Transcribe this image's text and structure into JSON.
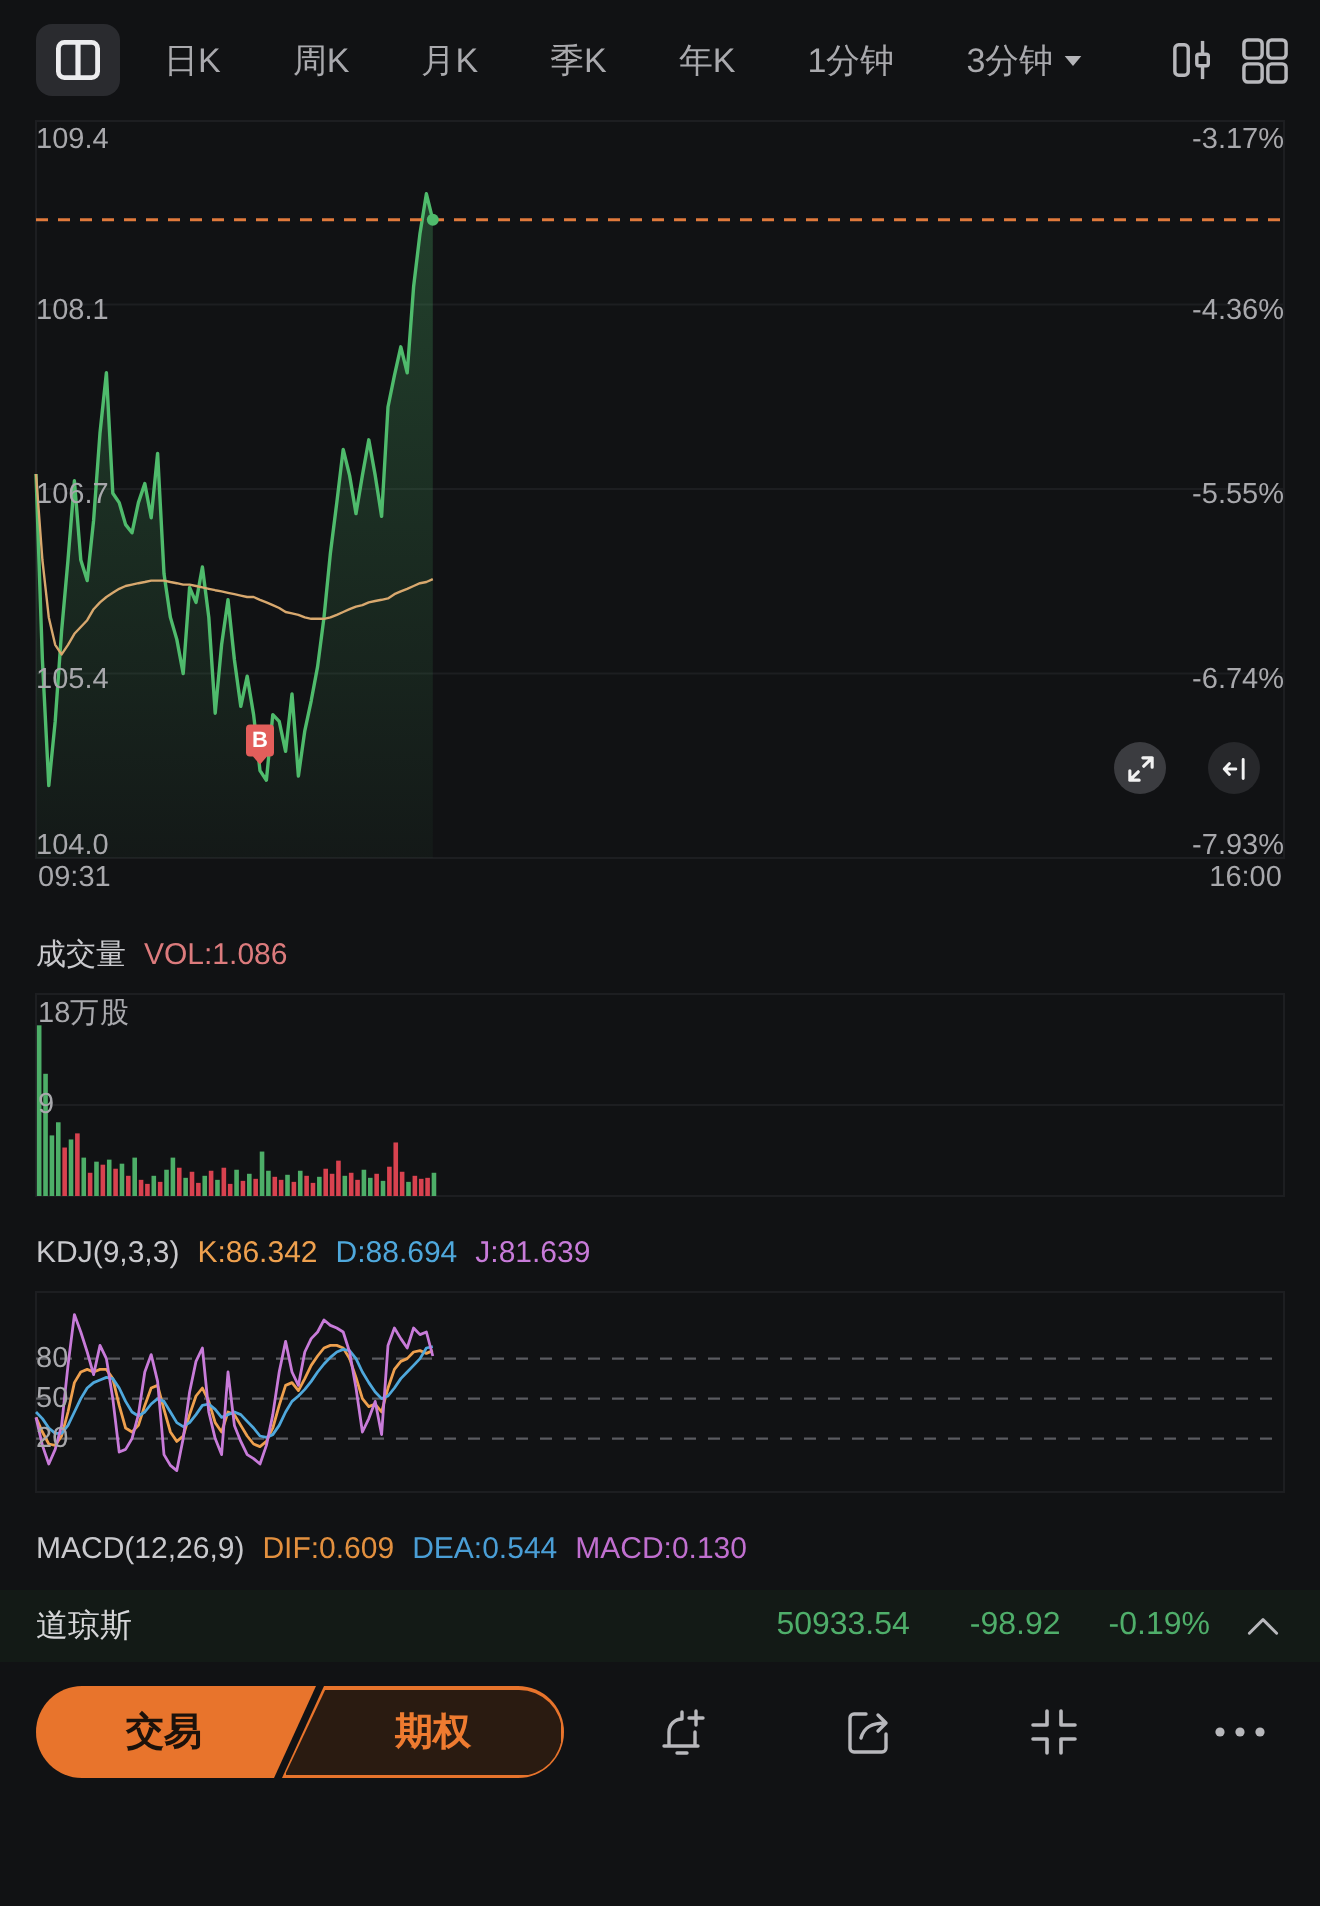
{
  "tabs": [
    {
      "kind": "icon",
      "selected": true
    },
    {
      "kind": "text",
      "label": "日K",
      "selected": false
    },
    {
      "kind": "text",
      "label": "周K",
      "selected": false
    },
    {
      "kind": "text",
      "label": "月K",
      "selected": false
    },
    {
      "kind": "text",
      "label": "季K",
      "selected": false
    },
    {
      "kind": "text",
      "label": "年K",
      "selected": false
    },
    {
      "kind": "text",
      "label": "1分钟",
      "selected": false
    },
    {
      "kind": "menu",
      "label": "3分钟",
      "selected": false
    }
  ],
  "price_chart": {
    "percent_labels": [
      "-3.17%",
      "-4.36%",
      "-5.55%",
      "-6.74%",
      "-7.93%"
    ],
    "chart_data": {
      "type": "line",
      "grid": true,
      "categories": [
        null,
        null,
        null,
        null,
        null,
        null,
        "09:31",
        null,
        null,
        null,
        null,
        null,
        null,
        null,
        null,
        null,
        null,
        null,
        null,
        null,
        null,
        null,
        null,
        null,
        null,
        null,
        null,
        null,
        null,
        null,
        null,
        null,
        null,
        null,
        null,
        null,
        null,
        null,
        null,
        null,
        null,
        null,
        null,
        null,
        null,
        null,
        null,
        null,
        null,
        null,
        null,
        null,
        null,
        null,
        null,
        null,
        null,
        null,
        null,
        null,
        null,
        null,
        null,
        null,
        null,
        null,
        null,
        null,
        null,
        null,
        null,
        null,
        null,
        null,
        null,
        null,
        null,
        null,
        null,
        null,
        null,
        null,
        null,
        null,
        null,
        null,
        null,
        null,
        null,
        null,
        null,
        null,
        null,
        null,
        null,
        null,
        null,
        null,
        null,
        null,
        null,
        null,
        null,
        null,
        null,
        null,
        null,
        null,
        null,
        null,
        null,
        null,
        null,
        null,
        null,
        null,
        null,
        null,
        null,
        null,
        null,
        null,
        null,
        null,
        null,
        null,
        null,
        null,
        null,
        null,
        null,
        null,
        null,
        null,
        null,
        null,
        null,
        null,
        null,
        null,
        null,
        null,
        null,
        null,
        null,
        null,
        null,
        null,
        null,
        null,
        null,
        null,
        null,
        null,
        null,
        null,
        null,
        null,
        null,
        null,
        null,
        null,
        null,
        null,
        null,
        null,
        null,
        null,
        null,
        null,
        null,
        null,
        null,
        null,
        null,
        null,
        null,
        null,
        null,
        null,
        null,
        null,
        null,
        null,
        null,
        null,
        null,
        null,
        null,
        "16:00",
        null,
        null,
        null,
        null,
        null,
        null
      ],
      "ylim": [
        104,
        109.4
      ],
      "yticks": [
        109.4,
        {
          "value": 108.05,
          "label": "108.1"
        },
        106.7,
        {
          "value": 105.35,
          "label": "105.4"
        },
        {
          "value": 104,
          "label": "104.0"
        }
      ],
      "series": [
        {
          "color": "#4fbb6c",
          "values": [
            106.81,
            105.45,
            104.53,
            105.0,
            105.66,
            106.18,
            106.76,
            106.18,
            106.03,
            106.47,
            107.11,
            107.55,
            106.67,
            106.6,
            106.44,
            106.38,
            106.6,
            106.74,
            106.49,
            106.96,
            106.08,
            105.76,
            105.6,
            105.35,
            105.98,
            105.87,
            106.13,
            105.76,
            105.06,
            105.56,
            105.89,
            105.45,
            105.11,
            105.33,
            105.05,
            104.64,
            104.57,
            105.05,
            105.0,
            104.78,
            105.2,
            104.6,
            104.93,
            105.15,
            105.4,
            105.76,
            106.23,
            106.6,
            106.99,
            106.8,
            106.52,
            106.8,
            107.06,
            106.8,
            106.5,
            107.3,
            107.53,
            107.74,
            107.55,
            108.18,
            108.57,
            108.86,
            108.67,
            null,
            null,
            null,
            null,
            null,
            null,
            null,
            null,
            null,
            null,
            null,
            null,
            null,
            null,
            null,
            null,
            null,
            null,
            null,
            null,
            null,
            null,
            null,
            null,
            null,
            null,
            null,
            null,
            null,
            null,
            null,
            null,
            null,
            null,
            null,
            null,
            null,
            null,
            null,
            null,
            null,
            null,
            null,
            null,
            null,
            null,
            null,
            null,
            null,
            null,
            null,
            null,
            null,
            null,
            null,
            null,
            null,
            null,
            null,
            null,
            null,
            null,
            null,
            null,
            null,
            null,
            null,
            null,
            null,
            null,
            null,
            null,
            null,
            null,
            null,
            null,
            null,
            null,
            null,
            null,
            null,
            null,
            null,
            null,
            null,
            null,
            null,
            null,
            null,
            null,
            null,
            null,
            null,
            null,
            null,
            null,
            null,
            null,
            null,
            null,
            null,
            null,
            null,
            null,
            null,
            null,
            null,
            null,
            null,
            null,
            null,
            null,
            null,
            null,
            null,
            null,
            null,
            null,
            null,
            null,
            null,
            null,
            null,
            null,
            null,
            null,
            null,
            null,
            null,
            null,
            null,
            null,
            null
          ]
        },
        {
          "color": "#d8a86e",
          "values": [
            106.81,
            106.18,
            105.76,
            105.56,
            105.49,
            105.56,
            105.64,
            105.69,
            105.74,
            105.82,
            105.87,
            105.91,
            105.94,
            105.97,
            105.99,
            106.0,
            106.01,
            106.02,
            106.03,
            106.03,
            106.03,
            106.02,
            106.01,
            106.0,
            106.0,
            105.99,
            105.98,
            105.97,
            105.96,
            105.95,
            105.94,
            105.93,
            105.92,
            105.91,
            105.91,
            105.89,
            105.87,
            105.85,
            105.83,
            105.8,
            105.79,
            105.78,
            105.76,
            105.75,
            105.75,
            105.75,
            105.76,
            105.78,
            105.8,
            105.82,
            105.84,
            105.85,
            105.87,
            105.88,
            105.89,
            105.9,
            105.93,
            105.95,
            105.97,
            105.99,
            106.01,
            106.02,
            106.04,
            null,
            null,
            null,
            null,
            null,
            null,
            null,
            null,
            null,
            null,
            null,
            null,
            null,
            null,
            null,
            null,
            null,
            null,
            null,
            null,
            null,
            null,
            null,
            null,
            null,
            null,
            null,
            null,
            null,
            null,
            null,
            null,
            null,
            null,
            null,
            null,
            null,
            null,
            null,
            null,
            null,
            null,
            null,
            null,
            null,
            null,
            null,
            null,
            null,
            null,
            null,
            null,
            null,
            null,
            null,
            null,
            null,
            null,
            null,
            null,
            null,
            null,
            null,
            null,
            null,
            null,
            null,
            null,
            null,
            null,
            null,
            null,
            null,
            null,
            null,
            null,
            null,
            null,
            null,
            null,
            null,
            null,
            null,
            null,
            null,
            null,
            null,
            null,
            null,
            null,
            null,
            null,
            null,
            null,
            null,
            null,
            null,
            null,
            null,
            null,
            null,
            null,
            null,
            null,
            null,
            null,
            null,
            null,
            null,
            null,
            null,
            null,
            null,
            null,
            null,
            null,
            null,
            null,
            null,
            null,
            null,
            null,
            null,
            null,
            null,
            null,
            null,
            null,
            null,
            null,
            null,
            null,
            null
          ]
        }
      ],
      "ref_lines": [
        {
          "axis": "y",
          "value": 108.67,
          "color": "#e07a3c"
        }
      ],
      "annotations": [
        {
          "text": "B",
          "y": 104.64
        }
      ]
    }
  },
  "volume": {
    "title": "成交量",
    "reading": "VOL:1.086",
    "chart_data": {
      "type": "bar",
      "stacked": true,
      "grid": true,
      "categories": [
        null,
        null,
        null,
        null,
        null,
        null,
        null,
        null,
        null,
        null,
        null,
        null,
        null,
        null,
        null,
        null,
        null,
        null,
        null,
        null,
        null,
        null,
        null,
        null,
        null,
        null,
        null,
        null,
        null,
        null,
        null,
        null,
        null,
        null,
        null,
        null,
        null,
        null,
        null,
        null,
        null,
        null,
        null,
        null,
        null,
        null,
        null,
        null,
        null,
        null,
        null,
        null,
        null,
        null,
        null,
        null,
        null,
        null,
        null,
        null,
        null,
        null,
        null,
        null,
        null,
        null,
        null,
        null,
        null,
        null,
        null,
        null,
        null,
        null,
        null,
        null,
        null,
        null,
        null,
        null,
        null,
        null,
        null,
        null,
        null,
        null,
        null,
        null,
        null,
        null,
        null,
        null,
        null,
        null,
        null,
        null,
        null,
        null,
        null,
        null,
        null,
        null,
        null,
        null,
        null,
        null,
        null,
        null,
        null,
        null,
        null,
        null,
        null,
        null,
        null,
        null,
        null,
        null,
        null,
        null,
        null,
        null,
        null,
        null,
        null,
        null,
        null,
        null,
        null,
        null,
        null,
        null,
        null,
        null,
        null,
        null,
        null,
        null,
        null,
        null,
        null,
        null,
        null,
        null,
        null,
        null,
        null,
        null,
        null,
        null,
        null,
        null,
        null,
        null,
        null,
        null,
        null,
        null,
        null,
        null,
        null,
        null,
        null,
        null,
        null,
        null,
        null,
        null,
        null,
        null,
        null,
        null,
        null,
        null,
        null,
        null,
        null,
        null,
        null,
        null,
        null,
        null,
        null,
        null,
        null,
        null,
        null,
        null,
        null,
        null,
        null,
        null,
        null,
        null,
        null,
        null
      ],
      "ylim": [
        0,
        20
      ],
      "yticks": [
        {
          "value": 18,
          "label": "18万股"
        },
        9
      ],
      "series": [
        {
          "color": "#4dae68",
          "values": [
            16.9,
            12.1,
            6.0,
            7.3,
            null,
            5.6,
            null,
            3.8,
            null,
            3.4,
            null,
            3.6,
            null,
            3.2,
            null,
            3.8,
            null,
            null,
            2.0,
            null,
            2.6,
            3.8,
            null,
            1.8,
            null,
            null,
            2.0,
            null,
            1.6,
            null,
            null,
            2.6,
            null,
            2.2,
            null,
            4.4,
            2.5,
            null,
            null,
            2.1,
            null,
            2.5,
            null,
            null,
            1.9,
            null,
            null,
            null,
            2.0,
            null,
            null,
            2.6,
            1.8,
            null,
            1.5,
            null,
            null,
            null,
            1.4,
            null,
            null,
            null,
            2.3,
            null,
            null,
            null,
            null,
            null,
            null,
            null,
            null,
            null,
            null,
            null,
            null,
            null,
            null,
            null,
            null,
            null,
            null,
            null,
            null,
            null,
            null,
            null,
            null,
            null,
            null,
            null,
            null,
            null,
            null,
            null,
            null,
            null,
            null,
            null,
            null,
            null,
            null,
            null,
            null,
            null,
            null,
            null,
            null,
            null,
            null,
            null,
            null,
            null,
            null,
            null,
            null,
            null,
            null,
            null,
            null,
            null,
            null,
            null,
            null,
            null,
            null,
            null,
            null,
            null,
            null,
            null,
            null,
            null,
            null,
            null,
            null,
            null,
            null,
            null,
            null,
            null,
            null,
            null,
            null,
            null,
            null,
            null,
            null,
            null,
            null,
            null,
            null,
            null,
            null,
            null,
            null,
            null,
            null,
            null,
            null,
            null,
            null,
            null,
            null,
            null,
            null,
            null,
            null,
            null,
            null,
            null,
            null,
            null,
            null,
            null,
            null,
            null,
            null,
            null,
            null,
            null,
            null,
            null,
            null,
            null,
            null,
            null,
            null,
            null,
            null,
            null,
            null,
            null,
            null,
            null,
            null,
            null
          ]
        },
        {
          "color": "#d8424f",
          "values": [
            null,
            null,
            null,
            null,
            4.8,
            null,
            6.2,
            null,
            2.3,
            null,
            3.1,
            null,
            2.7,
            null,
            2.0,
            null,
            1.6,
            1.2,
            null,
            1.4,
            null,
            null,
            2.8,
            null,
            2.4,
            1.3,
            null,
            2.5,
            null,
            2.8,
            1.2,
            null,
            1.5,
            null,
            1.7,
            null,
            null,
            1.9,
            1.6,
            null,
            1.4,
            null,
            2.0,
            1.3,
            null,
            2.7,
            2.2,
            3.5,
            null,
            2.3,
            1.6,
            null,
            null,
            2.2,
            null,
            2.9,
            5.3,
            2.4,
            null,
            2.0,
            1.7,
            1.8,
            null,
            null,
            null,
            null,
            null,
            null,
            null,
            null,
            null,
            null,
            null,
            null,
            null,
            null,
            null,
            null,
            null,
            null,
            null,
            null,
            null,
            null,
            null,
            null,
            null,
            null,
            null,
            null,
            null,
            null,
            null,
            null,
            null,
            null,
            null,
            null,
            null,
            null,
            null,
            null,
            null,
            null,
            null,
            null,
            null,
            null,
            null,
            null,
            null,
            null,
            null,
            null,
            null,
            null,
            null,
            null,
            null,
            null,
            null,
            null,
            null,
            null,
            null,
            null,
            null,
            null,
            null,
            null,
            null,
            null,
            null,
            null,
            null,
            null,
            null,
            null,
            null,
            null,
            null,
            null,
            null,
            null,
            null,
            null,
            null,
            null,
            null,
            null,
            null,
            null,
            null,
            null,
            null,
            null,
            null,
            null,
            null,
            null,
            null,
            null,
            null,
            null,
            null,
            null,
            null,
            null,
            null,
            null,
            null,
            null,
            null,
            null,
            null,
            null,
            null,
            null,
            null,
            null,
            null,
            null,
            null,
            null,
            null,
            null,
            null,
            null,
            null,
            null,
            null,
            null,
            null,
            null,
            null,
            null
          ]
        }
      ]
    }
  },
  "kdj": {
    "title": "KDJ(9,3,3)",
    "readings": [
      {
        "text": "K:86.342",
        "color": "#eea04e"
      },
      {
        "text": "D:88.694",
        "color": "#4fa8dc"
      },
      {
        "text": "J:81.639",
        "color": "#c87bd9"
      }
    ],
    "chart_data": {
      "type": "line",
      "grid": true,
      "categories": [
        null,
        null,
        null,
        null,
        null,
        null,
        null,
        null,
        null,
        null,
        null,
        null,
        null,
        null,
        null,
        null,
        null,
        null,
        null,
        null,
        null,
        null,
        null,
        null,
        null,
        null,
        null,
        null,
        null,
        null,
        null,
        null,
        null,
        null,
        null,
        null,
        null,
        null,
        null,
        null,
        null,
        null,
        null,
        null,
        null,
        null,
        null,
        null,
        null,
        null,
        null,
        null,
        null,
        null,
        null,
        null,
        null,
        null,
        null,
        null,
        null,
        null,
        null,
        null,
        null,
        null,
        null,
        null,
        null,
        null,
        null,
        null,
        null,
        null,
        null,
        null,
        null,
        null,
        null,
        null,
        null,
        null,
        null,
        null,
        null,
        null,
        null,
        null,
        null,
        null,
        null,
        null,
        null,
        null,
        null,
        null,
        null,
        null,
        null,
        null,
        null,
        null,
        null,
        null,
        null,
        null,
        null,
        null,
        null,
        null,
        null,
        null,
        null,
        null,
        null,
        null,
        null,
        null,
        null,
        null,
        null,
        null,
        null,
        null,
        null,
        null,
        null,
        null,
        null,
        null,
        null,
        null,
        null,
        null,
        null,
        null,
        null,
        null,
        null,
        null,
        null,
        null,
        null,
        null,
        null,
        null,
        null,
        null,
        null,
        null,
        null,
        null,
        null,
        null,
        null,
        null,
        null,
        null,
        null,
        null,
        null,
        null,
        null,
        null,
        null,
        null,
        null,
        null,
        null,
        null,
        null,
        null,
        null,
        null,
        null,
        null,
        null,
        null,
        null,
        null,
        null,
        null,
        null,
        null,
        null,
        null,
        null,
        null,
        null,
        null,
        null,
        null,
        null,
        null,
        null,
        null
      ],
      "ylim": [
        -20,
        130
      ],
      "yticks": [
        80,
        50,
        20
      ],
      "series": [
        {
          "color": "#eea04e",
          "values": [
            36,
            25,
            16,
            15,
            22,
            40,
            62,
            70,
            72,
            70,
            72,
            72,
            65,
            45,
            28,
            25,
            30,
            45,
            58,
            60,
            42,
            25,
            18,
            22,
            38,
            52,
            58,
            48,
            32,
            25,
            40,
            38,
            30,
            22,
            16,
            14,
            18,
            28,
            45,
            60,
            62,
            56,
            65,
            75,
            82,
            88,
            90,
            90,
            88,
            80,
            66,
            50,
            44,
            46,
            40,
            58,
            72,
            78,
            80,
            85,
            86,
            84,
            86,
            null,
            null,
            null,
            null,
            null,
            null,
            null,
            null,
            null,
            null,
            null,
            null,
            null,
            null,
            null,
            null,
            null,
            null,
            null,
            null,
            null,
            null,
            null,
            null,
            null,
            null,
            null,
            null,
            null,
            null,
            null,
            null,
            null,
            null,
            null,
            null,
            null,
            null,
            null,
            null,
            null,
            null,
            null,
            null,
            null,
            null,
            null,
            null,
            null,
            null,
            null,
            null,
            null,
            null,
            null,
            null,
            null,
            null,
            null,
            null,
            null,
            null,
            null,
            null,
            null,
            null,
            null,
            null,
            null,
            null,
            null,
            null,
            null,
            null,
            null,
            null,
            null,
            null,
            null,
            null,
            null,
            null,
            null,
            null,
            null,
            null,
            null,
            null,
            null,
            null,
            null,
            null,
            null,
            null,
            null,
            null,
            null,
            null,
            null,
            null,
            null,
            null,
            null,
            null,
            null,
            null,
            null,
            null,
            null,
            null,
            null,
            null,
            null,
            null,
            null,
            null,
            null,
            null,
            null,
            null,
            null,
            null,
            null,
            null,
            null,
            null,
            null,
            null,
            null,
            null,
            null,
            null,
            null
          ]
        },
        {
          "color": "#4fa8dc",
          "values": [
            40,
            35,
            28,
            24,
            24,
            30,
            40,
            50,
            58,
            62,
            64,
            66,
            65,
            58,
            48,
            40,
            37,
            40,
            46,
            50,
            48,
            40,
            32,
            29,
            32,
            38,
            45,
            46,
            42,
            36,
            38,
            40,
            38,
            33,
            28,
            22,
            21,
            23,
            30,
            40,
            48,
            52,
            57,
            63,
            70,
            76,
            81,
            85,
            87,
            86,
            80,
            70,
            62,
            55,
            50,
            52,
            58,
            65,
            70,
            75,
            80,
            88,
            89,
            null,
            null,
            null,
            null,
            null,
            null,
            null,
            null,
            null,
            null,
            null,
            null,
            null,
            null,
            null,
            null,
            null,
            null,
            null,
            null,
            null,
            null,
            null,
            null,
            null,
            null,
            null,
            null,
            null,
            null,
            null,
            null,
            null,
            null,
            null,
            null,
            null,
            null,
            null,
            null,
            null,
            null,
            null,
            null,
            null,
            null,
            null,
            null,
            null,
            null,
            null,
            null,
            null,
            null,
            null,
            null,
            null,
            null,
            null,
            null,
            null,
            null,
            null,
            null,
            null,
            null,
            null,
            null,
            null,
            null,
            null,
            null,
            null,
            null,
            null,
            null,
            null,
            null,
            null,
            null,
            null,
            null,
            null,
            null,
            null,
            null,
            null,
            null,
            null,
            null,
            null,
            null,
            null,
            null,
            null,
            null,
            null,
            null,
            null,
            null,
            null,
            null,
            null,
            null,
            null,
            null,
            null,
            null,
            null,
            null,
            null,
            null,
            null,
            null,
            null,
            null,
            null,
            null,
            null,
            null,
            null,
            null,
            null,
            null,
            null,
            null,
            null,
            null,
            null,
            null,
            null,
            null,
            null
          ]
        },
        {
          "color": "#c87bd9",
          "values": [
            36,
            15,
            1,
            12,
            30,
            75,
            113,
            100,
            85,
            68,
            90,
            80,
            50,
            10,
            12,
            20,
            38,
            70,
            83,
            63,
            8,
            0,
            -4,
            20,
            55,
            78,
            88,
            40,
            20,
            8,
            70,
            30,
            18,
            8,
            5,
            1,
            15,
            38,
            70,
            93,
            70,
            60,
            85,
            95,
            100,
            109,
            105,
            103,
            100,
            85,
            58,
            25,
            35,
            48,
            23,
            90,
            103,
            95,
            88,
            103,
            98,
            100,
            82,
            null,
            null,
            null,
            null,
            null,
            null,
            null,
            null,
            null,
            null,
            null,
            null,
            null,
            null,
            null,
            null,
            null,
            null,
            null,
            null,
            null,
            null,
            null,
            null,
            null,
            null,
            null,
            null,
            null,
            null,
            null,
            null,
            null,
            null,
            null,
            null,
            null,
            null,
            null,
            null,
            null,
            null,
            null,
            null,
            null,
            null,
            null,
            null,
            null,
            null,
            null,
            null,
            null,
            null,
            null,
            null,
            null,
            null,
            null,
            null,
            null,
            null,
            null,
            null,
            null,
            null,
            null,
            null,
            null,
            null,
            null,
            null,
            null,
            null,
            null,
            null,
            null,
            null,
            null,
            null,
            null,
            null,
            null,
            null,
            null,
            null,
            null,
            null,
            null,
            null,
            null,
            null,
            null,
            null,
            null,
            null,
            null,
            null,
            null,
            null,
            null,
            null,
            null,
            null,
            null,
            null,
            null,
            null,
            null,
            null,
            null,
            null,
            null,
            null,
            null,
            null,
            null,
            null,
            null,
            null,
            null,
            null,
            null,
            null,
            null,
            null,
            null,
            null,
            null,
            null,
            null,
            null,
            null
          ]
        }
      ]
    }
  },
  "macd": {
    "title": "MACD(12,26,9)",
    "readings": [
      {
        "text": "DIF:0.609",
        "color": "#e3903f"
      },
      {
        "text": "DEA:0.544",
        "color": "#4a9ed6"
      },
      {
        "text": "MACD:0.130",
        "color": "#c06fcf"
      }
    ]
  },
  "ticker": {
    "name": "道琼斯",
    "price": "50933.54",
    "change": "-98.92",
    "change_percent": "-0.19%"
  },
  "actions": {
    "trade": "交易",
    "options": "期权"
  }
}
